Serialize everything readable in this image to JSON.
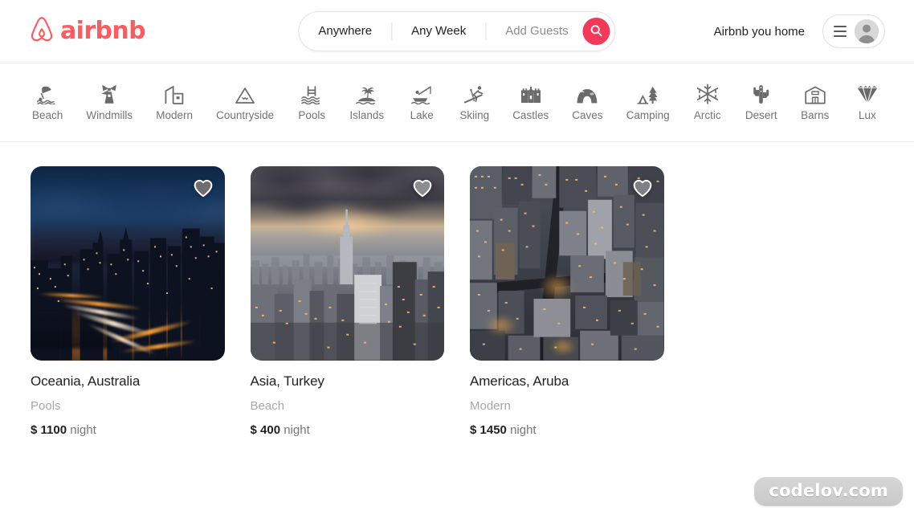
{
  "brand": {
    "name": "airbnb",
    "color": "#FF5A5F",
    "logo_icon": "airbnb-belo-logo"
  },
  "header": {
    "search": {
      "location_label": "Anywhere",
      "dates_label": "Any Week",
      "guests_label": "Add Guests",
      "search_icon": "search-icon",
      "search_button_color": "#F2395A"
    },
    "host_link": "Airbnb you home",
    "menu_icon": "hamburger-menu-icon",
    "avatar_icon": "user-avatar-icon"
  },
  "categories": [
    {
      "label": "Beach",
      "icon": "beach-umbrella-icon"
    },
    {
      "label": "Windmills",
      "icon": "windmill-icon"
    },
    {
      "label": "Modern",
      "icon": "modern-building-icon"
    },
    {
      "label": "Countryside",
      "icon": "mountain-icon"
    },
    {
      "label": "Pools",
      "icon": "pool-ladder-icon"
    },
    {
      "label": "Islands",
      "icon": "palm-island-icon"
    },
    {
      "label": "Lake",
      "icon": "fishing-boat-icon"
    },
    {
      "label": "Skiing",
      "icon": "skier-icon"
    },
    {
      "label": "Castles",
      "icon": "castle-icon"
    },
    {
      "label": "Caves",
      "icon": "cave-icon"
    },
    {
      "label": "Camping",
      "icon": "tent-tree-icon"
    },
    {
      "label": "Arctic",
      "icon": "snowflake-icon"
    },
    {
      "label": "Desert",
      "icon": "cactus-icon"
    },
    {
      "label": "Barns",
      "icon": "barn-icon"
    },
    {
      "label": "Lux",
      "icon": "diamond-icon"
    }
  ],
  "listings": [
    {
      "title": "Oceania, Australia",
      "category": "Pools",
      "currency": "$",
      "price": "1100",
      "price_unit": "night",
      "photo_alt": "night-city-skyline-with-light-trails",
      "favorite_icon": "heart-icon",
      "favorited": false
    },
    {
      "title": "Asia, Turkey",
      "category": "Beach",
      "currency": "$",
      "price": "400",
      "price_unit": "night",
      "photo_alt": "city-skyline-at-dusk-with-clouds",
      "favorite_icon": "heart-icon",
      "favorited": false
    },
    {
      "title": "Americas, Aruba",
      "category": "Modern",
      "currency": "$",
      "price": "1450",
      "price_unit": "night",
      "photo_alt": "aerial-view-of-dense-city-blocks",
      "favorite_icon": "heart-icon",
      "favorited": false
    }
  ],
  "watermark": "codelov.com"
}
